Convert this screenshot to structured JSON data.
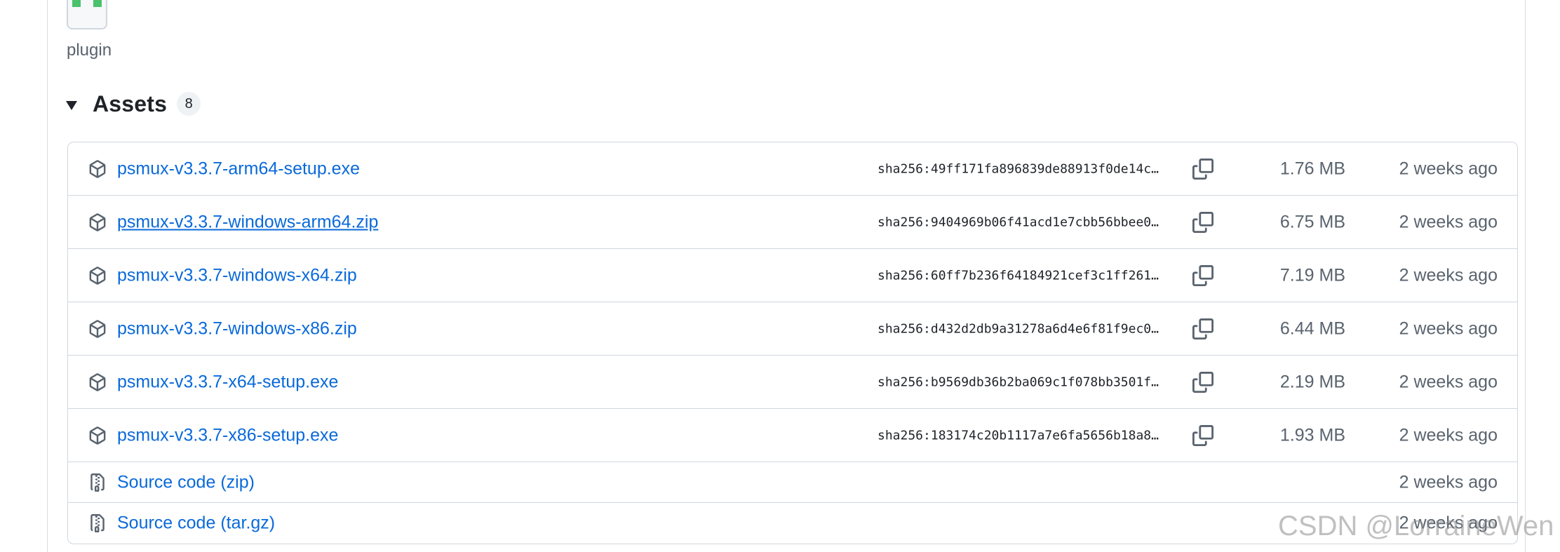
{
  "reactor": {
    "label": "plugin"
  },
  "assets": {
    "title": "Assets",
    "count": "8",
    "rows": [
      {
        "name": "psmux-v3.3.7-arm64-setup.exe",
        "sha": "sha256:49ff171fa896839de88913f0de14c…",
        "size": "1.76 MB",
        "time": "2 weeks ago"
      },
      {
        "name": "psmux-v3.3.7-windows-arm64.zip",
        "sha": "sha256:9404969b06f41acd1e7cbb56bbee0…",
        "size": "6.75 MB",
        "time": "2 weeks ago"
      },
      {
        "name": "psmux-v3.3.7-windows-x64.zip",
        "sha": "sha256:60ff7b236f64184921cef3c1ff261…",
        "size": "7.19 MB",
        "time": "2 weeks ago"
      },
      {
        "name": "psmux-v3.3.7-windows-x86.zip",
        "sha": "sha256:d432d2db9a31278a6d4e6f81f9ec0…",
        "size": "6.44 MB",
        "time": "2 weeks ago"
      },
      {
        "name": "psmux-v3.3.7-x64-setup.exe",
        "sha": "sha256:b9569db36b2ba069c1f078bb3501f…",
        "size": "2.19 MB",
        "time": "2 weeks ago"
      },
      {
        "name": "psmux-v3.3.7-x86-setup.exe",
        "sha": "sha256:183174c20b1117a7e6fa5656b18a8…",
        "size": "1.93 MB",
        "time": "2 weeks ago"
      }
    ],
    "source": [
      {
        "label": "Source code",
        "format": "(zip)",
        "time": "2 weeks ago"
      },
      {
        "label": "Source code",
        "format": "(tar.gz)",
        "time": "2 weeks ago"
      }
    ]
  },
  "icons": {
    "package": "package-icon",
    "copy": "copy-icon",
    "file_zip": "file-zip-icon",
    "disclosure": "triangle-down-icon"
  },
  "colors": {
    "link": "#0969da",
    "muted": "#59636e",
    "border": "#d0d7de",
    "avatar_accent": "#4ac26b"
  },
  "watermark": "CSDN @LorraineWen"
}
